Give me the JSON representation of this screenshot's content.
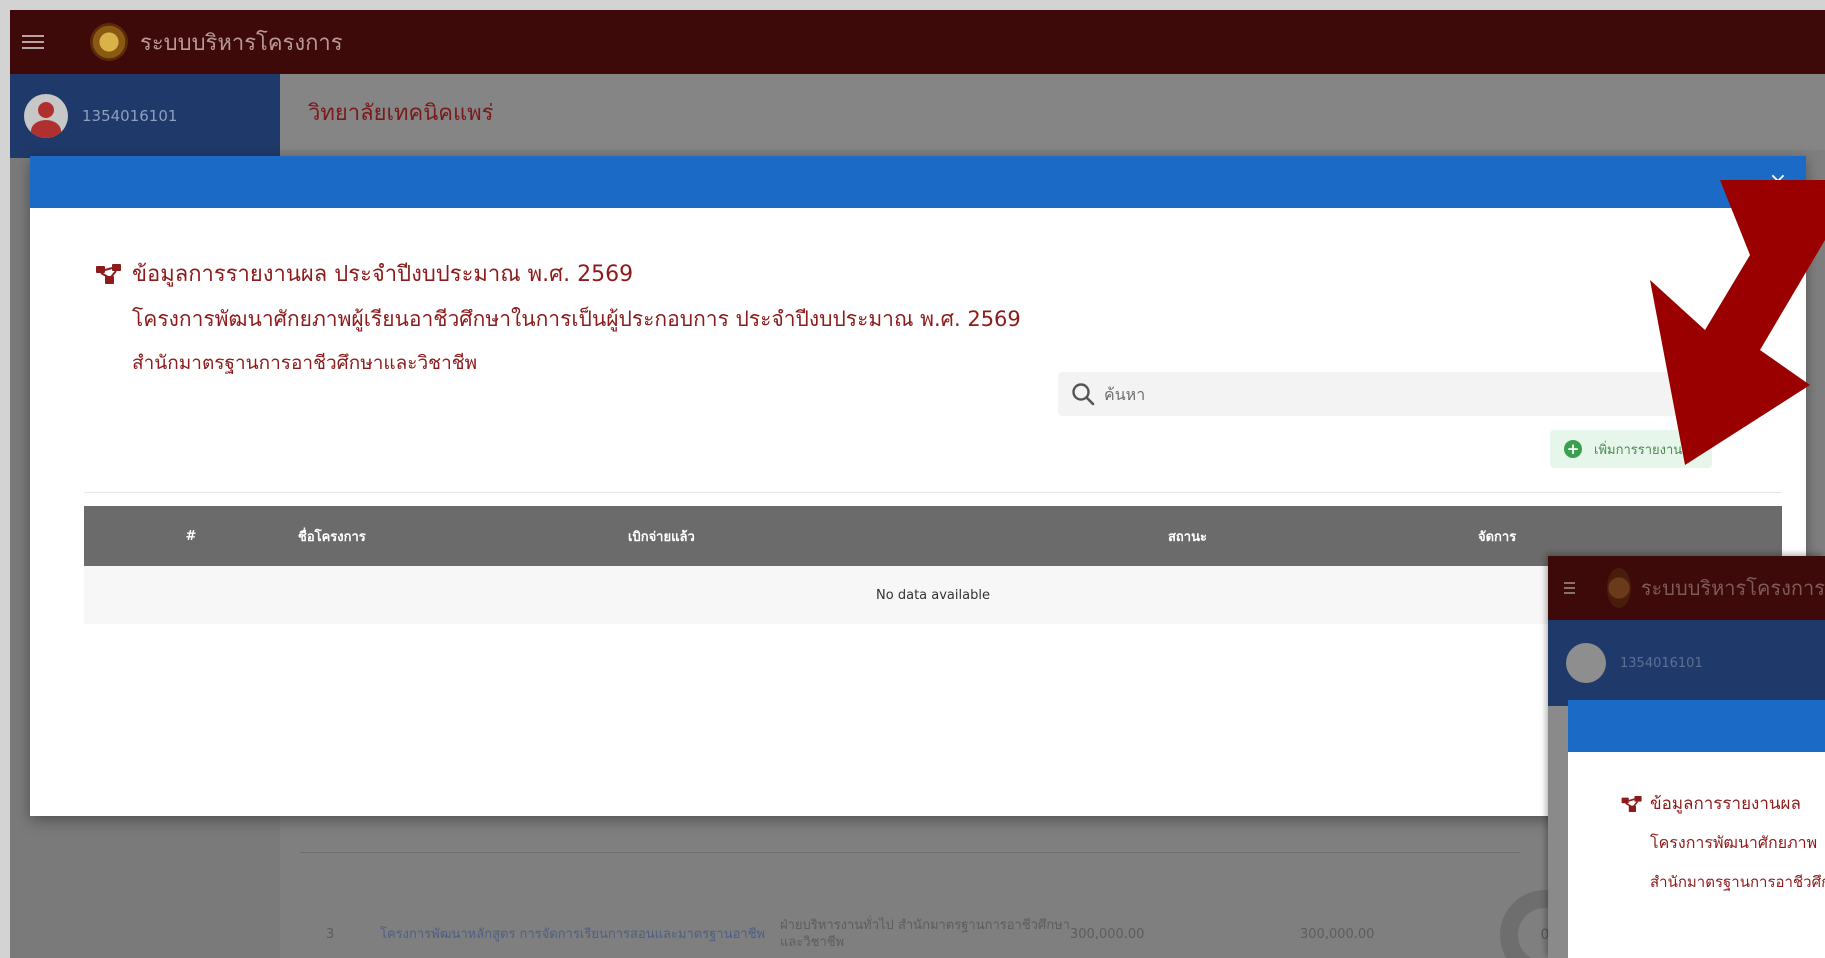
{
  "app": {
    "title": "ระบบบริหารโครงการ",
    "user_id": "1354016101",
    "college": "วิทยาลัยเทคนิคแพร่"
  },
  "background_row": {
    "no": "3",
    "project": "โครงการพัฒนาหลักสูตร การจัดการเรียนการสอนและมาตรฐานอาชีพ",
    "department": "ฝ่ายบริหารงานทั่วไป สำนักมาตรฐานการอาชีวศึกษาและวิชาชีพ",
    "budget": "300,000.00",
    "amount": "300,000.00",
    "donut_value": "0"
  },
  "modal": {
    "close_label": "×",
    "heading": "ข้อมูลการรายงานผล ประจำปีงบประมาณ พ.ศ. 2569",
    "project_name": "โครงการพัฒนาศักยภาพผู้เรียนอาชีวศึกษาในการเป็นผู้ประกอบการ ประจำปีงบประมาณ พ.ศ. 2569",
    "department": "สำนักมาตรฐานการอาชีวศึกษาและวิชาชีพ",
    "search_placeholder": "ค้นหา",
    "add_button_label": "เพิ่มการรายงานผล",
    "table": {
      "headers": [
        "#",
        "ชื่อโครงการ",
        "เบิกจ่ายแล้ว",
        "สถานะ",
        "จัดการ"
      ],
      "empty_text": "No data available"
    }
  },
  "inset": {
    "app_title": "ระบบบริหารโครงการ",
    "user_id": "1354016101",
    "heading": "ข้อมูลการรายงานผล",
    "project_name": "โครงการพัฒนาศักยภาพ",
    "department": "สำนักมาตรฐานการอาชีวศึกษา"
  },
  "colors": {
    "topbar": "#3d0909",
    "modal_header": "#1a6ac6",
    "heading_text": "#8e1b1b",
    "table_header": "#6b6b6b",
    "add_button_bg": "#e7f6ea",
    "add_button_icon": "#3aa04e",
    "arrow": "#9a0000"
  },
  "icons": {
    "menu": "hamburger-icon",
    "close": "close-icon",
    "heading": "sitemap-icon",
    "search": "search-icon",
    "add": "plus-circle-icon",
    "avatar": "user-avatar-icon",
    "arrow": "red-arrow-annotation"
  }
}
